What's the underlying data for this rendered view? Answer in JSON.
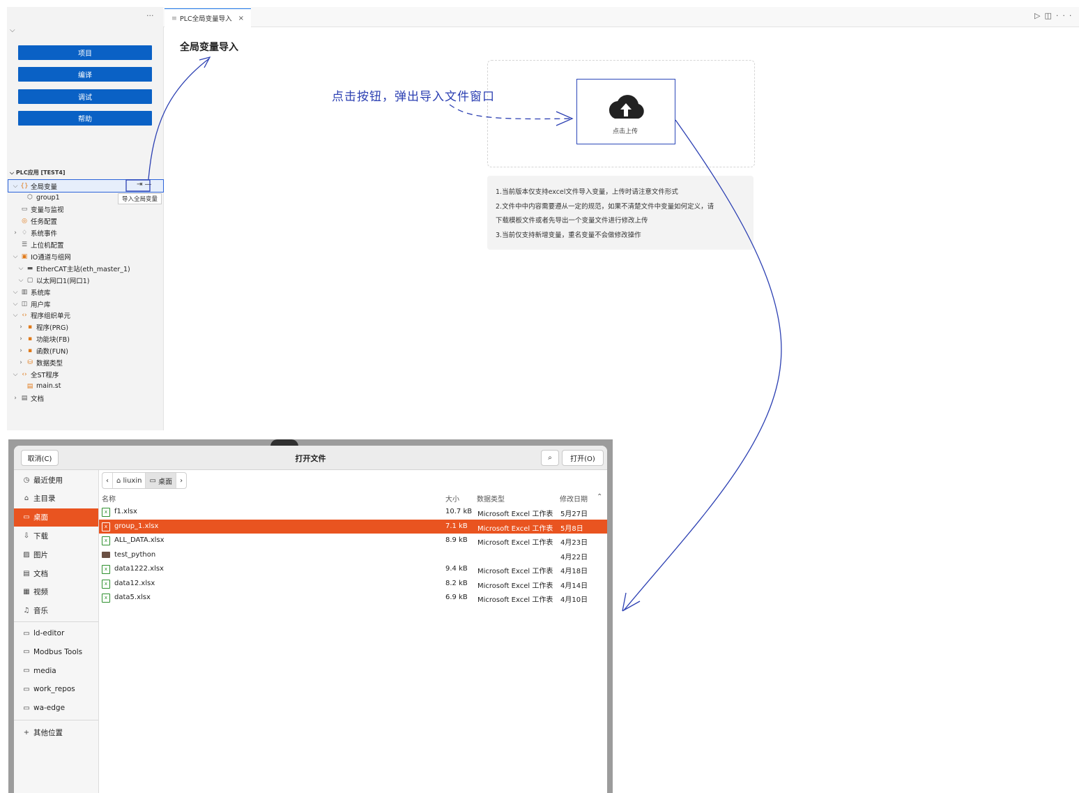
{
  "sidebar": {
    "menu_dots": "···",
    "buttons": [
      "项目",
      "编译",
      "调试",
      "帮助"
    ],
    "tree_header": "PLC应用 [TEST4]",
    "tree": [
      {
        "label": "全局变量",
        "arrow": "⌵",
        "icon": "{}"
      },
      {
        "label": "group1",
        "arrow": "",
        "icon": "⬡"
      },
      {
        "label": "变量与监视",
        "arrow": "",
        "icon": "▭"
      },
      {
        "label": "任务配置",
        "arrow": "",
        "icon": "◎"
      },
      {
        "label": "系统事件",
        "arrow": "›",
        "icon": "♢"
      },
      {
        "label": "上位机配置",
        "arrow": "",
        "icon": "☰"
      },
      {
        "label": "IO通道与组网",
        "arrow": "⌵",
        "icon": "▣"
      },
      {
        "label": "EtherCAT主站(eth_master_1)",
        "arrow": "⌵",
        "icon": "▬"
      },
      {
        "label": "以太网口1(网口1)",
        "arrow": "⌵",
        "icon": "▢"
      },
      {
        "label": "系统库",
        "arrow": "⌵",
        "icon": "▥"
      },
      {
        "label": "用户库",
        "arrow": "⌵",
        "icon": "◫"
      },
      {
        "label": "程序组织单元",
        "arrow": "⌵",
        "icon": "‹›"
      },
      {
        "label": "程序(PRG)",
        "arrow": "›",
        "icon": "▪"
      },
      {
        "label": "功能块(FB)",
        "arrow": "›",
        "icon": "▪"
      },
      {
        "label": "函数(FUN)",
        "arrow": "›",
        "icon": "▪"
      },
      {
        "label": "数据类型",
        "arrow": "›",
        "icon": "⛁"
      },
      {
        "label": "全ST程序",
        "arrow": "⌵",
        "icon": "‹›"
      },
      {
        "label": "main.st",
        "arrow": "",
        "icon": "▤"
      },
      {
        "label": "文档",
        "arrow": "›",
        "icon": "▤"
      }
    ],
    "tooltip": "导入全局变量"
  },
  "editor": {
    "tab_label": "PLC全局变量导入",
    "tab_close": "×",
    "page_title": "全局变量导入",
    "upload_label": "点击上传",
    "notes": [
      "1.当前版本仅支持excel文件导入变量，上传时请注意文件形式",
      "2.文件中中内容需要遵从一定的规范，如果不清楚文件中变量如何定义，请",
      "下载模板文件或者先导出一个变量文件进行修改上传",
      "3.当前仅支持新增变量，重名变量不会做修改操作"
    ],
    "annotation": "点击按钮，弹出导入文件窗口"
  },
  "dialog": {
    "title": "打开文件",
    "cancel": "取消(C)",
    "open": "打开(O)",
    "places": [
      {
        "label": "最近使用",
        "icon": "◷"
      },
      {
        "label": "主目录",
        "icon": "⌂"
      },
      {
        "label": "桌面",
        "icon": "▭"
      },
      {
        "label": "下载",
        "icon": "⇩"
      },
      {
        "label": "图片",
        "icon": "▨"
      },
      {
        "label": "文档",
        "icon": "▤"
      },
      {
        "label": "视频",
        "icon": "▦"
      },
      {
        "label": "音乐",
        "icon": "♫"
      }
    ],
    "bookmarks": [
      "ld-editor",
      "Modbus Tools",
      "media",
      "work_repos",
      "wa-edge"
    ],
    "other": "其他位置",
    "crumbs": [
      "liuxin",
      "桌面"
    ],
    "columns": {
      "name": "名称",
      "size": "大小",
      "type": "数据类型",
      "date": "修改日期"
    },
    "files": [
      {
        "name": "f1.xlsx",
        "size": "10.7 kB",
        "type": "Microsoft Excel 工作表",
        "date": "5月27日"
      },
      {
        "name": "group_1.xlsx",
        "size": "7.1 kB",
        "type": "Microsoft Excel 工作表",
        "date": "5月8日"
      },
      {
        "name": "ALL_DATA.xlsx",
        "size": "8.9 kB",
        "type": "Microsoft Excel 工作表",
        "date": "4月23日"
      },
      {
        "name": "test_python",
        "size": "",
        "type": "",
        "date": "4月22日"
      },
      {
        "name": "data1222.xlsx",
        "size": "9.4 kB",
        "type": "Microsoft Excel 工作表",
        "date": "4月18日"
      },
      {
        "name": "data12.xlsx",
        "size": "8.2 kB",
        "type": "Microsoft Excel 工作表",
        "date": "4月14日"
      },
      {
        "name": "data5.xlsx",
        "size": "6.9 kB",
        "type": "Microsoft Excel 工作表",
        "date": "4月10日"
      }
    ]
  },
  "colors": {
    "accent": "#0a61c5",
    "selection": "#e95420",
    "annotation": "#2b3fb2"
  }
}
